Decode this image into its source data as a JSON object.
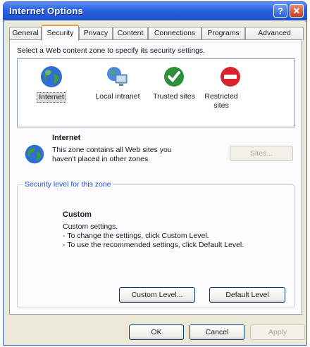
{
  "window": {
    "title": "Internet Options"
  },
  "tabs": [
    {
      "label": "General"
    },
    {
      "label": "Security",
      "active": true
    },
    {
      "label": "Privacy"
    },
    {
      "label": "Content"
    },
    {
      "label": "Connections"
    },
    {
      "label": "Programs"
    },
    {
      "label": "Advanced"
    }
  ],
  "security": {
    "instruction": "Select a Web content zone to specify its security settings.",
    "zones": [
      {
        "label": "Internet",
        "icon": "globe-icon",
        "selected": true
      },
      {
        "label": "Local intranet",
        "icon": "local-intranet-icon"
      },
      {
        "label": "Trusted sites",
        "icon": "checkmark-icon"
      },
      {
        "label": "Restricted sites",
        "icon": "restricted-icon"
      }
    ],
    "selected_zone": {
      "name": "Internet",
      "description": "This zone contains all Web sites you haven't placed in other zones",
      "sites_button": "Sites..."
    },
    "level_group": {
      "title": "Security level for this zone",
      "level_name": "Custom",
      "lines": [
        "Custom settings.",
        "- To change the settings, click Custom Level.",
        "- To use the recommended settings, click Default Level."
      ],
      "custom_level_button": "Custom Level...",
      "default_level_button": "Default Level"
    }
  },
  "footer": {
    "ok": "OK",
    "cancel": "Cancel",
    "apply": "Apply"
  },
  "colors": {
    "title_bar": "#2a62e0",
    "accent_tab": "#e79b3c",
    "group_title": "#1f4fd1"
  }
}
